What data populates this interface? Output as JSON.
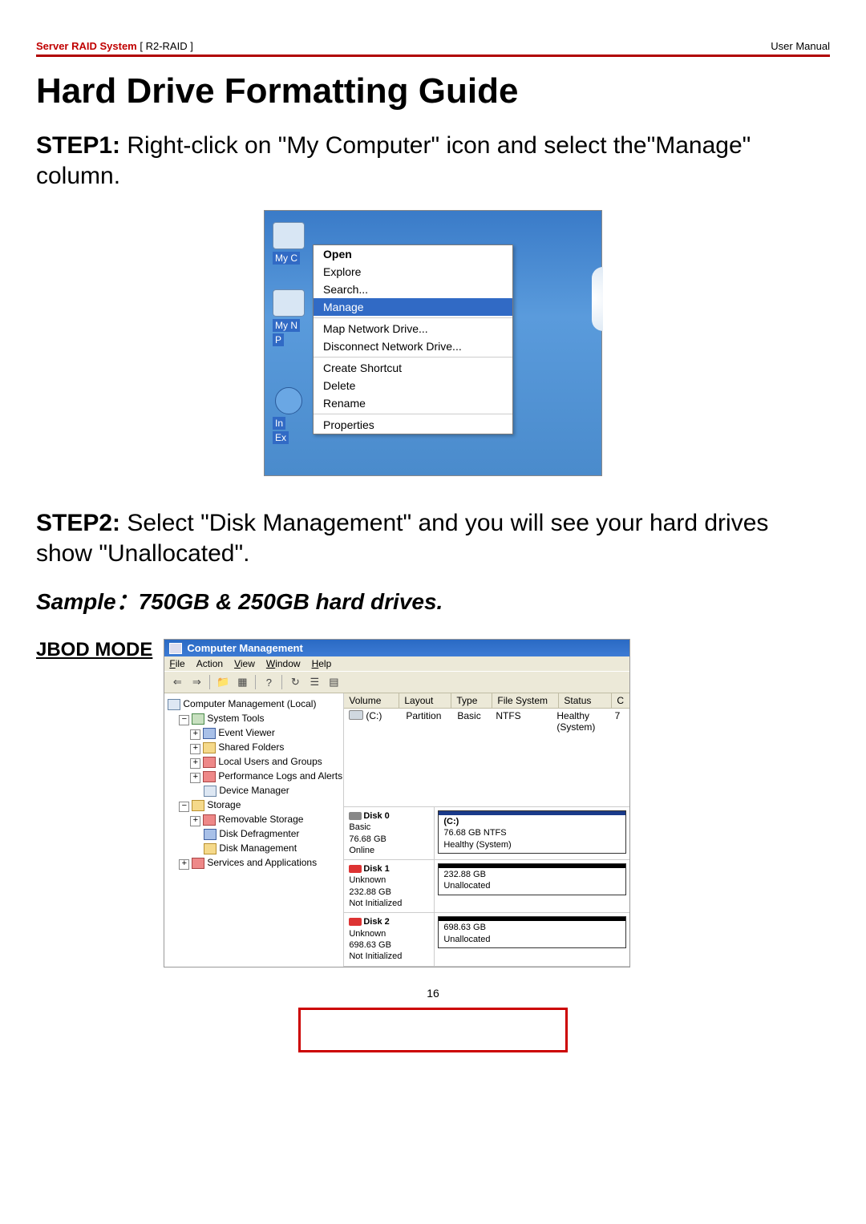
{
  "header": {
    "brand": "Server RAID System",
    "model": "[ R2-RAID ]",
    "right": "User Manual"
  },
  "title": "Hard Drive Formatting Guide",
  "step1": {
    "label": "STEP1:",
    "text": " Right-click on \"My Computer\" icon and select the\"Manage\" column."
  },
  "desktop": {
    "myc_label": "My C",
    "myn_label_l1": "My N",
    "myn_label_l2": "P",
    "in_label_l1": "In",
    "in_label_l2": "Ex"
  },
  "context_menu": {
    "open": "Open",
    "explore": "Explore",
    "search": "Search...",
    "manage": "Manage",
    "map": "Map Network Drive...",
    "disconnect": "Disconnect Network Drive...",
    "shortcut": "Create Shortcut",
    "delete": "Delete",
    "rename": "Rename",
    "properties": "Properties"
  },
  "step2": {
    "label": "STEP2:",
    "text": " Select \"Disk Management\" and you will see your hard drives show \"Unallocated\"."
  },
  "sample": "Sample：750GB & 250GB hard drives.",
  "jbod": "JBOD MODE",
  "cm": {
    "title": "Computer Management",
    "menu": {
      "file": "File",
      "action": "Action",
      "view": "View",
      "window": "Window",
      "help": "Help"
    },
    "tree": {
      "root": "Computer Management (Local)",
      "systools": "System Tools",
      "event": "Event Viewer",
      "shared": "Shared Folders",
      "users": "Local Users and Groups",
      "perf": "Performance Logs and Alerts",
      "devmgr": "Device Manager",
      "storage": "Storage",
      "removable": "Removable Storage",
      "defrag": "Disk Defragmenter",
      "diskmgmt": "Disk Management",
      "services": "Services and Applications"
    },
    "vol_headers": {
      "volume": "Volume",
      "layout": "Layout",
      "type": "Type",
      "fs": "File System",
      "status": "Status",
      "c": "C"
    },
    "vol_row": {
      "name": "(C:)",
      "layout": "Partition",
      "type": "Basic",
      "fs": "NTFS",
      "status": "Healthy (System)",
      "extra": "7"
    },
    "disks": {
      "d0": {
        "name": "Disk 0",
        "l1": "Basic",
        "l2": "76.68 GB",
        "l3": "Online",
        "bar_lbl": "(C:)",
        "bar_l1": "76.68 GB NTFS",
        "bar_l2": "Healthy (System)"
      },
      "d1": {
        "name": "Disk 1",
        "l1": "Unknown",
        "l2": "232.88 GB",
        "l3": "Not Initialized",
        "bar_l1": "232.88 GB",
        "bar_l2": "Unallocated"
      },
      "d2": {
        "name": "Disk 2",
        "l1": "Unknown",
        "l2": "698.63 GB",
        "l3": "Not Initialized",
        "bar_l1": "698.63 GB",
        "bar_l2": "Unallocated"
      }
    }
  },
  "page_number": "16"
}
